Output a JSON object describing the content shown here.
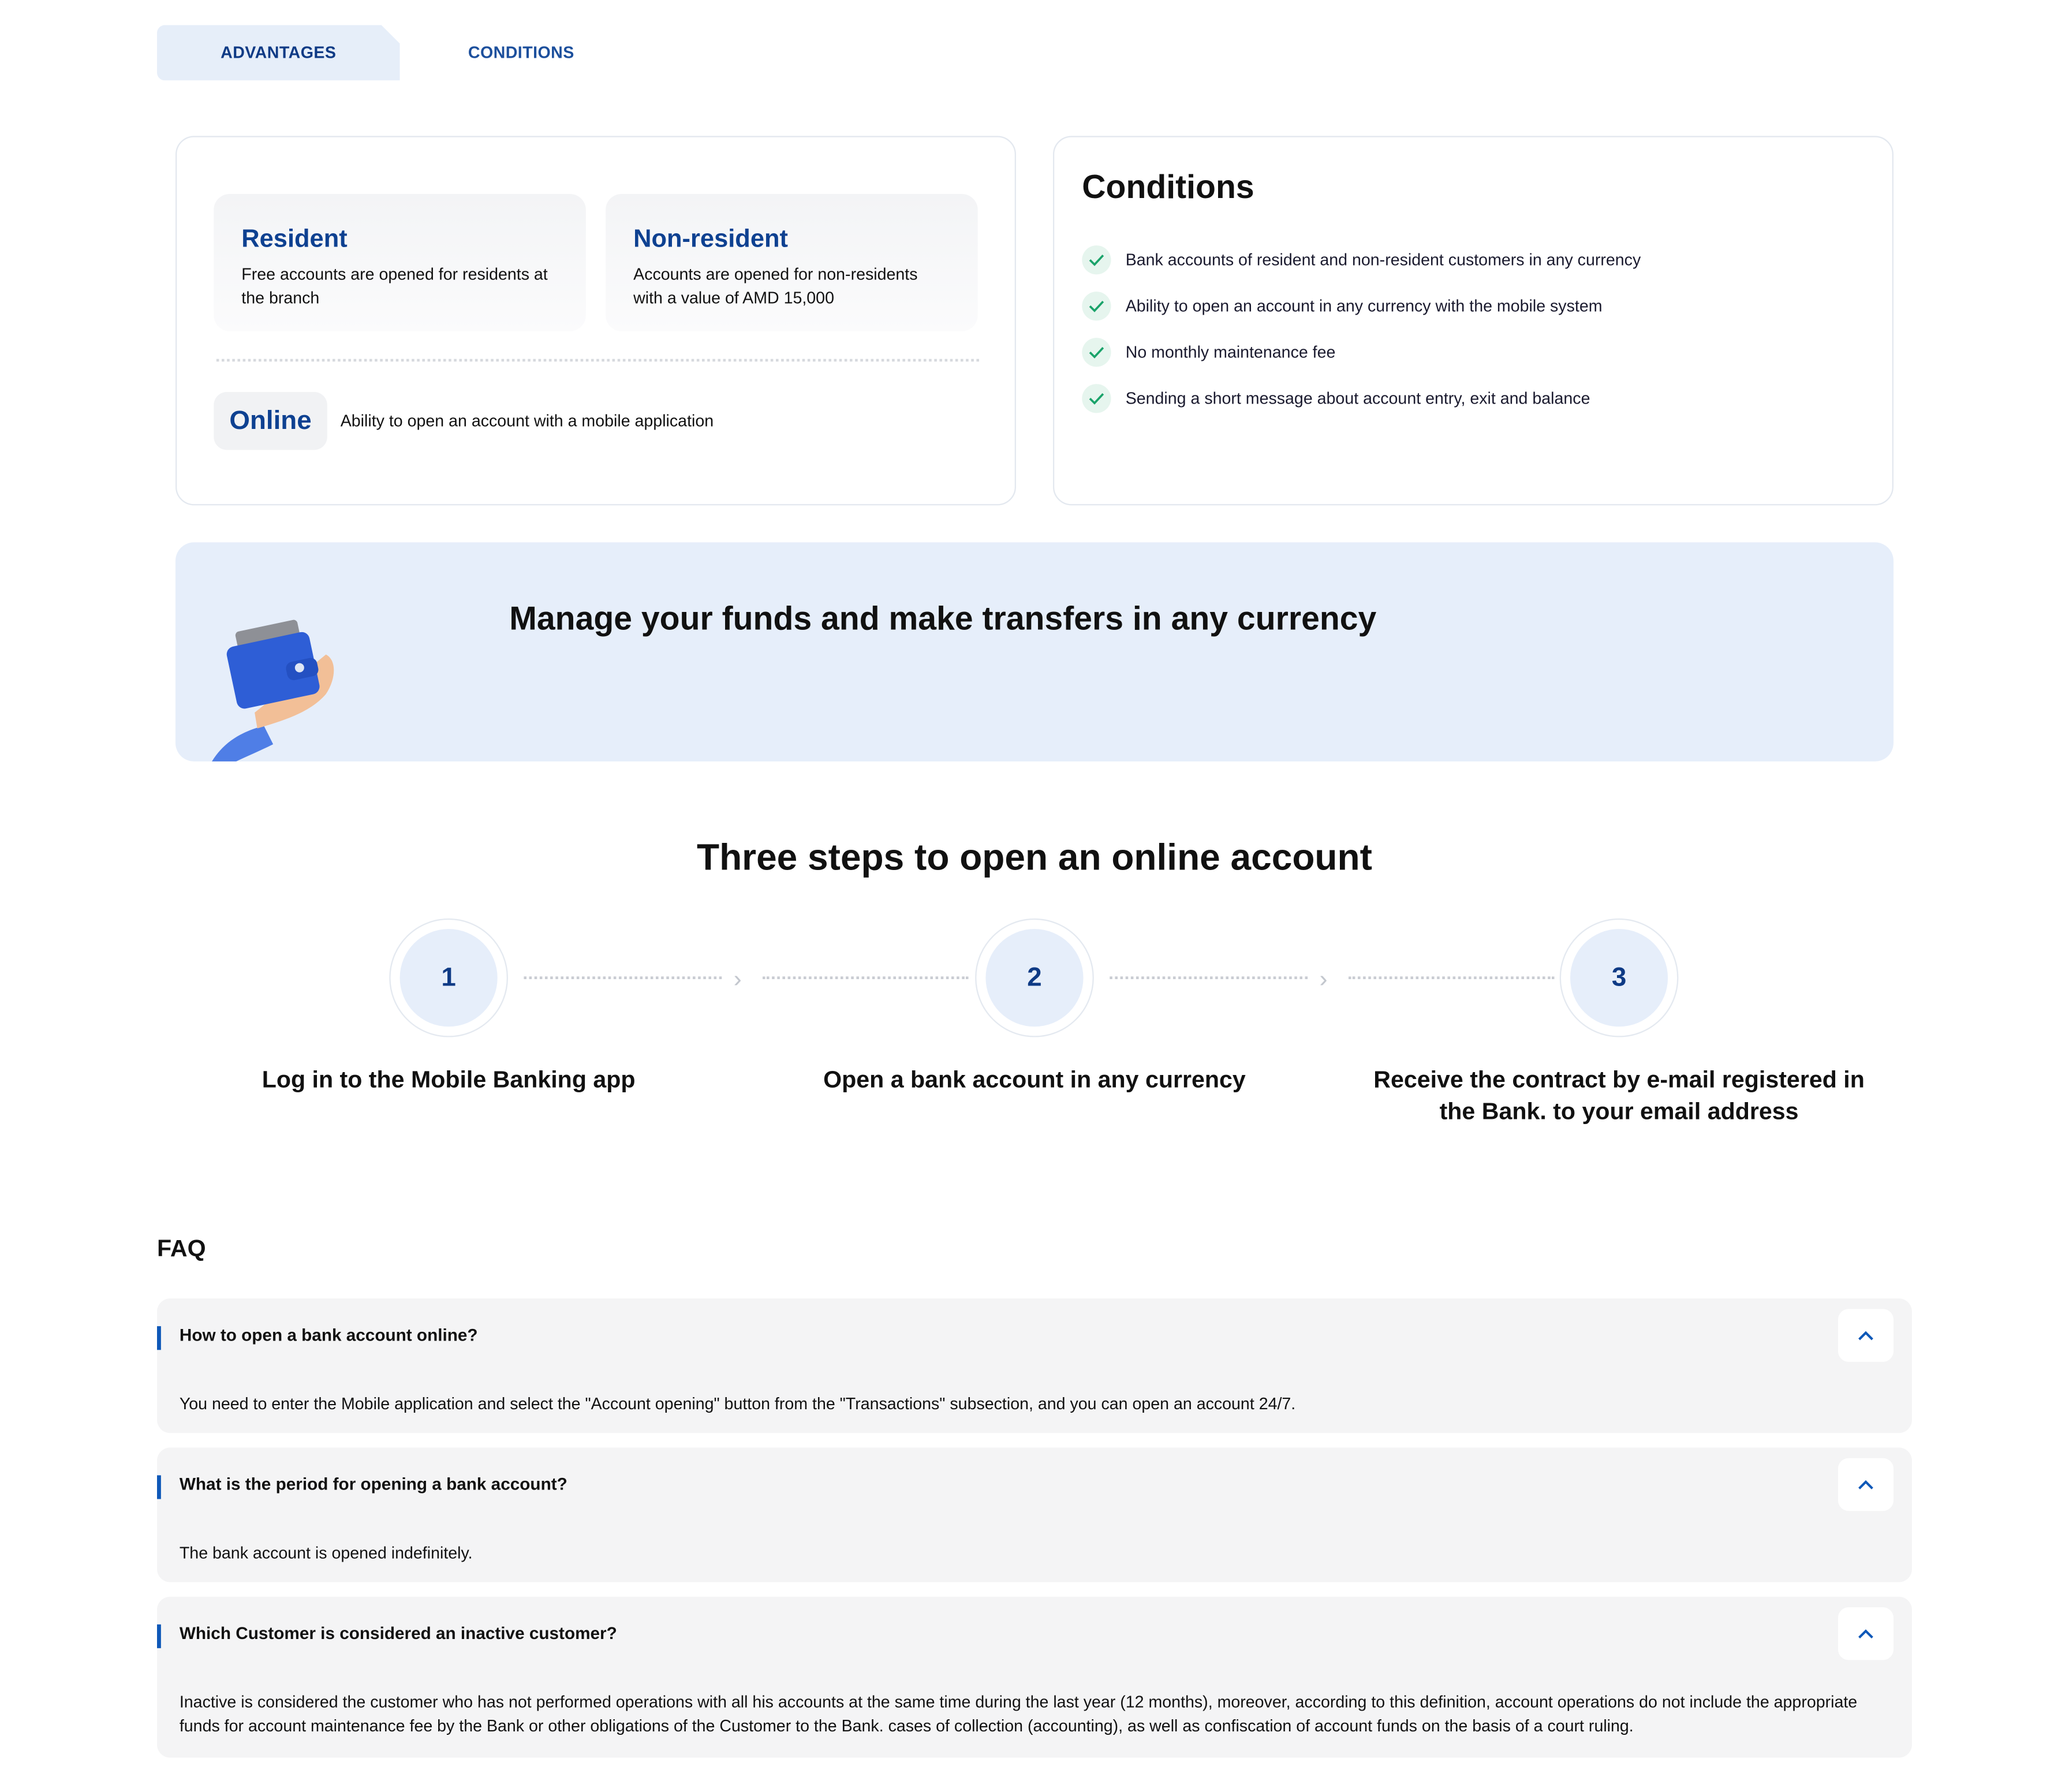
{
  "tabs": [
    "ADVANTAGES",
    "CONDITIONS"
  ],
  "account_types": {
    "resident": {
      "title": "Resident",
      "text": "Free accounts are opened for residents at the branch"
    },
    "non_resident": {
      "title": "Non-resident",
      "text": "Accounts are opened for non-residents with a value of AMD 15,000"
    },
    "online": {
      "title": "Online",
      "text": "Ability to open an account with a mobile application"
    }
  },
  "conditions": {
    "title": "Conditions",
    "items": [
      "Bank accounts of resident and non-resident customers in any currency",
      "Ability to open an account in any currency with the mobile system",
      "No monthly maintenance fee",
      "Sending a short message about account entry, exit and balance"
    ]
  },
  "banner": {
    "title": "Manage your funds and make transfers in any currency"
  },
  "steps": {
    "title": "Three steps to open an online account",
    "items": [
      {
        "number": "1",
        "label": "Log in to the Mobile Banking app"
      },
      {
        "number": "2",
        "label": "Open a bank account in any currency"
      },
      {
        "number": "3",
        "label": "Receive the contract by e-mail registered in the Bank. to your email address"
      }
    ]
  },
  "faq": {
    "title": "FAQ",
    "items": [
      {
        "question": "How to open a bank account online?",
        "answer": "You need to enter the Mobile application and select the \"Account opening\" button from the \"Transactions\" subsection, and you can open an account 24/7."
      },
      {
        "question": "What is the period for opening a bank account?",
        "answer": "The bank account is opened indefinitely."
      },
      {
        "question": "Which Customer is considered an inactive customer?",
        "answer": "Inactive is considered the customer who has not performed operations with all his accounts at the same time during the last year (12 months), moreover, according to this definition, account operations do not include the appropriate funds for account maintenance fee by the Bank or other obligations of the Customer to the Bank. cases of collection (accounting), as well as confiscation of account funds on the basis of a court ruling."
      }
    ]
  },
  "colors": {
    "brand": "#0e4191",
    "tab_bg": "#e6eef9",
    "check": "#1aa36a",
    "faq_bar": "#0e58b8"
  }
}
